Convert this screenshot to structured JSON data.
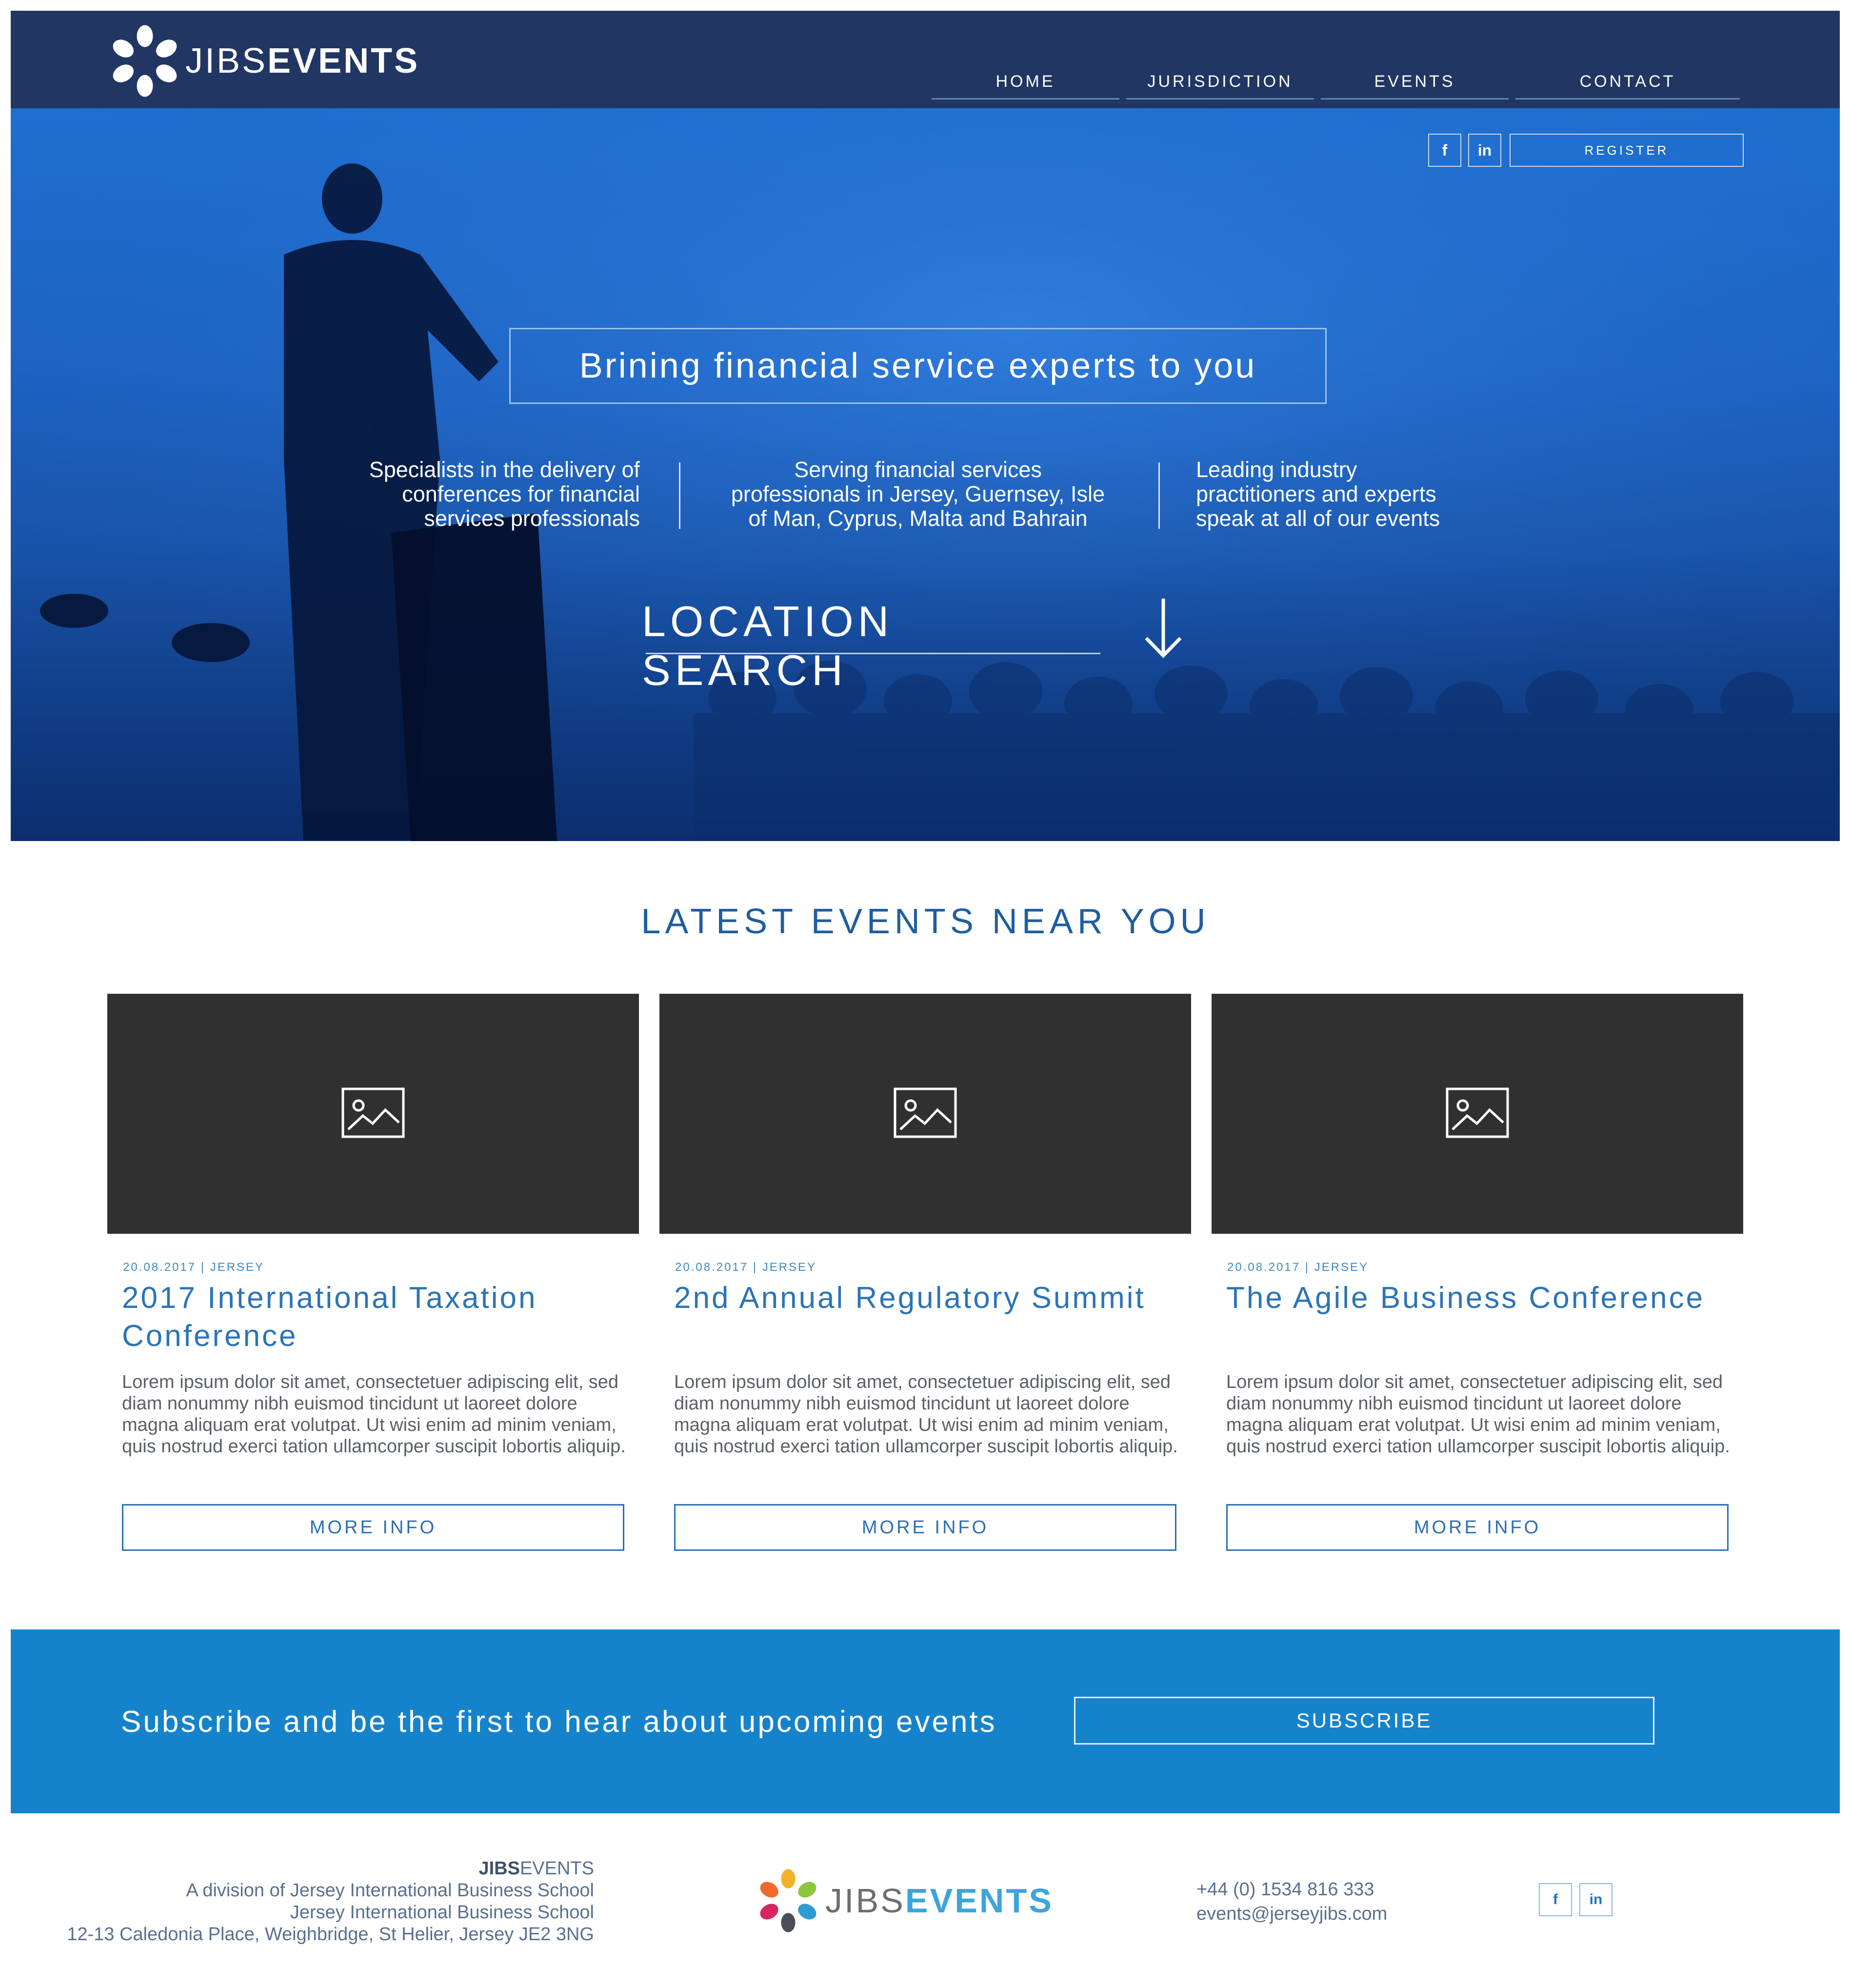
{
  "brand": {
    "name_part1": "JIBS",
    "name_part2": "EVENTS"
  },
  "nav": [
    {
      "label": "HOME"
    },
    {
      "label": "JURISDICTION"
    },
    {
      "label": "EVENTS"
    },
    {
      "label": "CONTACT"
    }
  ],
  "hero": {
    "social": {
      "facebook": "f",
      "linkedin": "in"
    },
    "register_label": "REGISTER",
    "tagline": "Brining financial service experts to you",
    "columns": [
      {
        "lines": [
          "Specialists in the delivery of",
          "conferences for financial",
          "services professionals"
        ]
      },
      {
        "lines": [
          "Serving financial services",
          "professionals in Jersey, Guernsey, Isle",
          "of Man, Cyprus, Malta and Bahrain"
        ]
      },
      {
        "lines": [
          "Leading industry",
          "practitioners and experts",
          "speak at all of our events"
        ]
      }
    ],
    "location_search": "LOCATION SEARCH"
  },
  "events_section": {
    "title": "LATEST EVENTS NEAR YOU",
    "cards": [
      {
        "meta": "20.08.2017 | JERSEY",
        "title": "2017 International Taxation Conference",
        "body": "Lorem ipsum dolor sit amet, consectetuer adipiscing elit, sed diam nonummy nibh euismod tincidunt ut laoreet dolore magna aliquam erat volutpat. Ut wisi enim ad minim veniam, quis nostrud exerci tation ullamcorper suscipit lobortis aliquip.",
        "button": "MORE INFO"
      },
      {
        "meta": "20.08.2017 | JERSEY",
        "title": "2nd Annual Regulatory Summit",
        "body": "Lorem ipsum dolor sit amet, consectetuer adipiscing elit, sed diam nonummy nibh euismod tincidunt ut laoreet dolore magna aliquam erat volutpat. Ut wisi enim ad minim veniam, quis nostrud exerci tation ullamcorper suscipit lobortis aliquip.",
        "button": "MORE INFO"
      },
      {
        "meta": "20.08.2017 | JERSEY",
        "title": "The Agile Business Conference",
        "body": "Lorem ipsum dolor sit amet, consectetuer adipiscing elit, sed diam nonummy nibh euismod tincidunt ut laoreet dolore magna aliquam erat volutpat. Ut wisi enim ad minim veniam, quis nostrud exerci tation ullamcorper suscipit lobortis aliquip.",
        "button": "MORE INFO"
      }
    ]
  },
  "subscribe": {
    "text": "Subscribe and be the first to hear about upcoming events",
    "button": "SUBSCRIBE"
  },
  "footer": {
    "brand_part1": "JIBS",
    "brand_part2": "EVENTS",
    "address_lines": [
      "A division of Jersey International Business School",
      "Jersey International Business School",
      "12-13 Caledonia Place, Weighbridge, St Helier, Jersey JE2 3NG"
    ],
    "phone": "+44 (0) 1534 816 333",
    "email": "events@jerseyjibs.com",
    "social": {
      "facebook": "f",
      "linkedin": "in"
    }
  },
  "colors": {
    "header_bg": "#213662",
    "hero_blue": "#1d63c2",
    "accent_blue": "#2b74b8",
    "subscribe_bg": "#1583cb",
    "card_image_bg": "#303030"
  },
  "icons": {
    "brand_logo": "flower-logo-icon",
    "arrow": "arrow-down-icon",
    "image_placeholder": "image-placeholder-icon"
  }
}
